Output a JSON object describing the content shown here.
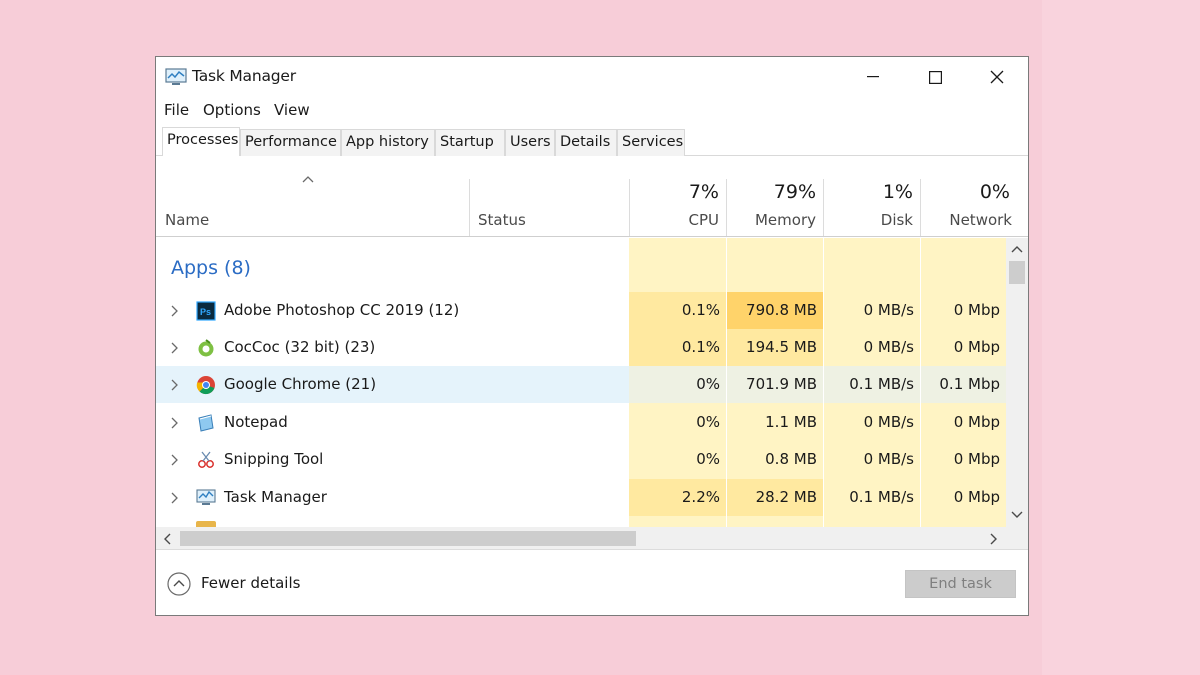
{
  "window": {
    "title": "Task Manager"
  },
  "menu": [
    "File",
    "Options",
    "View"
  ],
  "tabs": [
    {
      "label": "Processes",
      "active": true
    },
    {
      "label": "Performance",
      "active": false
    },
    {
      "label": "App history",
      "active": false
    },
    {
      "label": "Startup",
      "active": false
    },
    {
      "label": "Users",
      "active": false
    },
    {
      "label": "Details",
      "active": false
    },
    {
      "label": "Services",
      "active": false
    }
  ],
  "columns": {
    "name": "Name",
    "status": "Status",
    "cpu": {
      "percent": "7%",
      "label": "CPU"
    },
    "memory": {
      "percent": "79%",
      "label": "Memory"
    },
    "disk": {
      "percent": "1%",
      "label": "Disk"
    },
    "network": {
      "percent": "0%",
      "label": "Network"
    }
  },
  "group": {
    "title": "Apps (8)"
  },
  "rows": [
    {
      "name": "Adobe Photoshop CC 2019 (12)",
      "icon": "photoshop-icon",
      "cpu": "0.1%",
      "memory": "790.8 MB",
      "disk": "0 MB/s",
      "network": "0 Mbp",
      "selected": false
    },
    {
      "name": "CocCoc (32 bit) (23)",
      "icon": "coccoc-icon",
      "cpu": "0.1%",
      "memory": "194.5 MB",
      "disk": "0 MB/s",
      "network": "0 Mbp",
      "selected": false
    },
    {
      "name": "Google Chrome (21)",
      "icon": "chrome-icon",
      "cpu": "0%",
      "memory": "701.9 MB",
      "disk": "0.1 MB/s",
      "network": "0.1 Mbp",
      "selected": true
    },
    {
      "name": "Notepad",
      "icon": "notepad-icon",
      "cpu": "0%",
      "memory": "1.1 MB",
      "disk": "0 MB/s",
      "network": "0 Mbp",
      "selected": false
    },
    {
      "name": "Snipping Tool",
      "icon": "snipping-tool-icon",
      "cpu": "0%",
      "memory": "0.8 MB",
      "disk": "0 MB/s",
      "network": "0 Mbp",
      "selected": false
    },
    {
      "name": "Task Manager",
      "icon": "task-manager-icon",
      "cpu": "2.2%",
      "memory": "28.2 MB",
      "disk": "0.1 MB/s",
      "network": "0 Mbp",
      "selected": false
    }
  ],
  "footer": {
    "fewer_details": "Fewer details",
    "end_task": "End task"
  },
  "colors": {
    "background": "#f7cdd8",
    "group_title": "#2b6cc4",
    "heat_light": "#fff4c4",
    "heat_medium": "#ffe9a0",
    "heat_strong": "#ffd36a",
    "selection": "#e5f3fb"
  }
}
